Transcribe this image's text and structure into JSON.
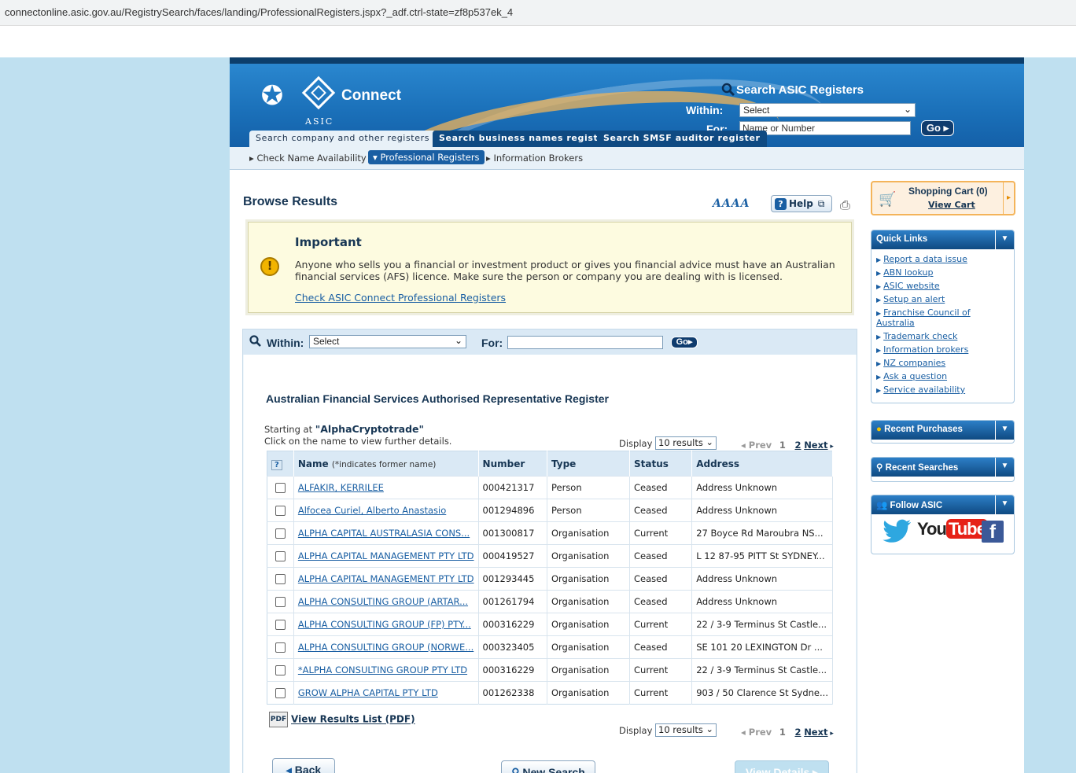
{
  "browser": {
    "url": "connectonline.asic.gov.au/RegistrySearch/faces/landing/ProfessionalRegisters.jspx?_adf.ctrl-state=zf8p537ek_4"
  },
  "header": {
    "asic_label": "ASIC",
    "connect_label": "Connect",
    "search_title": "Search ASIC Registers",
    "within_label": "Within:",
    "within_value": "Select",
    "for_label": "For:",
    "for_placeholder": "Name or Number",
    "go_label": "Go"
  },
  "tabs": [
    {
      "label": "Search company and other registers",
      "active": true
    },
    {
      "label": "Search business names register",
      "active": false
    },
    {
      "label": "Search SMSF auditor register",
      "active": false
    }
  ],
  "subnav": [
    {
      "label": "Check Name Availability"
    },
    {
      "label": "Professional Registers"
    },
    {
      "label": "Information Brokers"
    }
  ],
  "main": {
    "title": "Browse Results",
    "font_sizer": "AAAA",
    "help_label": "Help",
    "important": {
      "title": "Important",
      "body": "Anyone who sells you a financial or investment product or gives you financial advice must have an Australian financial services (AFS) licence. Make sure the person or company you are dealing with is licensed.",
      "link": "Check ASIC Connect Professional Registers"
    },
    "search": {
      "within_label": "Within:",
      "within_value": "Select",
      "for_label": "For:",
      "go_label": "Go"
    },
    "register_title": "Australian Financial Services Authorised Representative Register",
    "starting_label": "Starting at",
    "starting_value": "\"AlphaCryptotrade\"",
    "click_hint": "Click on the name to view further details.",
    "display_label": "Display",
    "display_value": "10 results",
    "pager": {
      "prev": "Prev",
      "page1": "1",
      "page2": "2",
      "next": "Next"
    },
    "table": {
      "help_icon": "?",
      "headers": {
        "name": "Name",
        "name_note": "(*indicates former name)",
        "number": "Number",
        "type": "Type",
        "status": "Status",
        "address": "Address"
      },
      "rows": [
        {
          "name": "ALFAKIR, KERRILEE",
          "number": "000421317",
          "type": "Person",
          "status": "Ceased",
          "address": "Address Unknown"
        },
        {
          "name": "Alfocea Curiel, Alberto Anastasio",
          "number": "001294896",
          "type": "Person",
          "status": "Ceased",
          "address": "Address Unknown"
        },
        {
          "name": "ALPHA CAPITAL AUSTRALASIA CONS...",
          "number": "001300817",
          "type": "Organisation",
          "status": "Current",
          "address": "27 Boyce Rd Maroubra NS..."
        },
        {
          "name": "ALPHA CAPITAL MANAGEMENT PTY LTD",
          "number": "000419527",
          "type": "Organisation",
          "status": "Ceased",
          "address": "L 12 87-95 PITT St SYDNEY..."
        },
        {
          "name": "ALPHA CAPITAL MANAGEMENT PTY LTD",
          "number": "001293445",
          "type": "Organisation",
          "status": "Ceased",
          "address": "Address Unknown"
        },
        {
          "name": "ALPHA CONSULTING GROUP (ARTAR...",
          "number": "001261794",
          "type": "Organisation",
          "status": "Ceased",
          "address": "Address Unknown"
        },
        {
          "name": "ALPHA CONSULTING GROUP (FP) PTY...",
          "number": "000316229",
          "type": "Organisation",
          "status": "Current",
          "address": "22 / 3-9 Terminus St Castle..."
        },
        {
          "name": "ALPHA CONSULTING GROUP (NORWE...",
          "number": "000323405",
          "type": "Organisation",
          "status": "Ceased",
          "address": "SE 101 20 LEXINGTON Dr ..."
        },
        {
          "name": "*ALPHA CONSULTING GROUP PTY LTD",
          "number": "000316229",
          "type": "Organisation",
          "status": "Current",
          "address": "22 / 3-9 Terminus St Castle..."
        },
        {
          "name": "GROW ALPHA CAPITAL PTY LTD",
          "number": "001262338",
          "type": "Organisation",
          "status": "Current",
          "address": "903 / 50 Clarence St Sydne..."
        }
      ]
    },
    "pdf_link": "View Results List (PDF)",
    "buttons": {
      "back": "Back",
      "new_search": "New Search",
      "view_details": "View Details"
    }
  },
  "sidebar": {
    "cart_title": "Shopping Cart (0)",
    "cart_link": "View Cart",
    "quick_links_title": "Quick Links",
    "quick_links": [
      "Report a data issue",
      "ABN lookup",
      "ASIC website",
      "Setup an alert",
      "Franchise Council of Australia",
      "Trademark check",
      "Information brokers",
      "NZ companies",
      "Ask a question",
      "Service availability"
    ],
    "recent_purchases": "Recent Purchases",
    "recent_searches": "Recent Searches",
    "follow_title": "Follow ASIC",
    "youtube_label": "YouTube"
  }
}
